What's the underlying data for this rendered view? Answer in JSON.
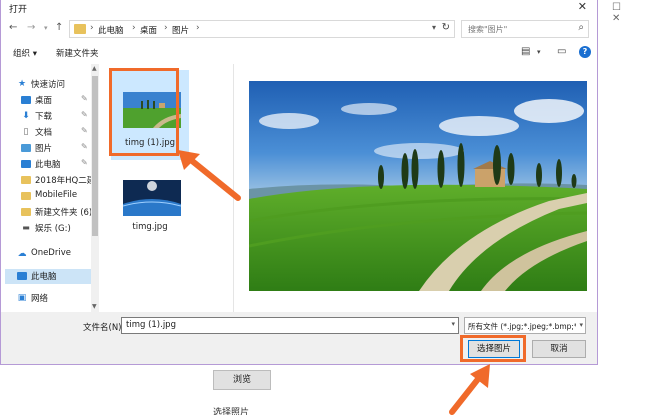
{
  "background": {
    "browse_label": "浏览",
    "hint_text": "选择照片"
  },
  "dialog": {
    "title": "打开",
    "close_glyph": "✕"
  },
  "navbar": {
    "breadcrumbs": [
      "此电脑",
      "桌面",
      "图片"
    ],
    "search_placeholder": "搜索\"图片\""
  },
  "toolbar": {
    "organize_label": "组织 ▾",
    "new_folder_label": "新建文件夹"
  },
  "nav_pane": {
    "items": [
      {
        "label": "快速访问",
        "icon": "star-icon",
        "pinned": false
      },
      {
        "label": "桌面",
        "icon": "desktop-icon",
        "pinned": true
      },
      {
        "label": "下载",
        "icon": "download-icon",
        "pinned": true
      },
      {
        "label": "文档",
        "icon": "document-icon",
        "pinned": true
      },
      {
        "label": "图片",
        "icon": "picture-icon",
        "pinned": true
      },
      {
        "label": "此电脑",
        "icon": "computer-icon",
        "pinned": true
      },
      {
        "label": "2018年HQ二建:",
        "icon": "folder-icon",
        "pinned": false
      },
      {
        "label": "MobileFile",
        "icon": "folder-icon",
        "pinned": false
      },
      {
        "label": "新建文件夹 (6)",
        "icon": "folder-icon",
        "pinned": false
      },
      {
        "label": "娱乐 (G:)",
        "icon": "drive-icon",
        "pinned": false
      },
      {
        "label": "OneDrive",
        "icon": "cloud-icon",
        "pinned": false
      },
      {
        "label": "此电脑",
        "icon": "computer-icon",
        "pinned": false,
        "selected": true
      },
      {
        "label": "网络",
        "icon": "network-icon",
        "pinned": false
      }
    ]
  },
  "files": [
    {
      "name": "timg (1).jpg",
      "selected": true
    },
    {
      "name": "timg.jpg",
      "selected": false
    }
  ],
  "bottom": {
    "filename_label": "文件名(N):",
    "filename_value": "timg (1).jpg",
    "filetype_value": "所有文件 (*.jpg;*.jpeg;*.bmp;*.",
    "open_label": "选择图片",
    "cancel_label": "取消"
  },
  "colors": {
    "highlight": "#f06a2a",
    "selection": "#cce8ff",
    "dialog_border": "#b59ad6"
  }
}
